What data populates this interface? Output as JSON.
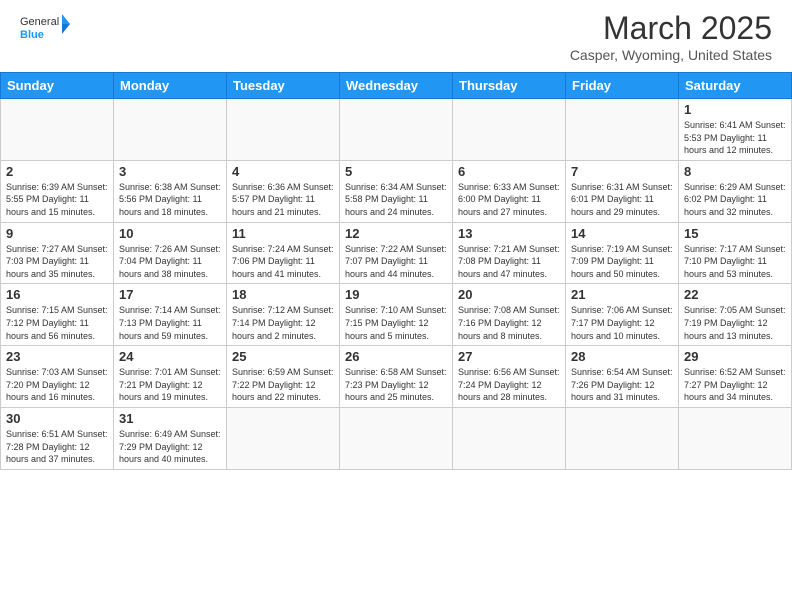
{
  "logo": {
    "text_general": "General",
    "text_blue": "Blue"
  },
  "title": "March 2025",
  "location": "Casper, Wyoming, United States",
  "weekdays": [
    "Sunday",
    "Monday",
    "Tuesday",
    "Wednesday",
    "Thursday",
    "Friday",
    "Saturday"
  ],
  "weeks": [
    [
      {
        "day": "",
        "info": ""
      },
      {
        "day": "",
        "info": ""
      },
      {
        "day": "",
        "info": ""
      },
      {
        "day": "",
        "info": ""
      },
      {
        "day": "",
        "info": ""
      },
      {
        "day": "",
        "info": ""
      },
      {
        "day": "1",
        "info": "Sunrise: 6:41 AM\nSunset: 5:53 PM\nDaylight: 11 hours and 12 minutes."
      }
    ],
    [
      {
        "day": "2",
        "info": "Sunrise: 6:39 AM\nSunset: 5:55 PM\nDaylight: 11 hours and 15 minutes."
      },
      {
        "day": "3",
        "info": "Sunrise: 6:38 AM\nSunset: 5:56 PM\nDaylight: 11 hours and 18 minutes."
      },
      {
        "day": "4",
        "info": "Sunrise: 6:36 AM\nSunset: 5:57 PM\nDaylight: 11 hours and 21 minutes."
      },
      {
        "day": "5",
        "info": "Sunrise: 6:34 AM\nSunset: 5:58 PM\nDaylight: 11 hours and 24 minutes."
      },
      {
        "day": "6",
        "info": "Sunrise: 6:33 AM\nSunset: 6:00 PM\nDaylight: 11 hours and 27 minutes."
      },
      {
        "day": "7",
        "info": "Sunrise: 6:31 AM\nSunset: 6:01 PM\nDaylight: 11 hours and 29 minutes."
      },
      {
        "day": "8",
        "info": "Sunrise: 6:29 AM\nSunset: 6:02 PM\nDaylight: 11 hours and 32 minutes."
      }
    ],
    [
      {
        "day": "9",
        "info": "Sunrise: 7:27 AM\nSunset: 7:03 PM\nDaylight: 11 hours and 35 minutes."
      },
      {
        "day": "10",
        "info": "Sunrise: 7:26 AM\nSunset: 7:04 PM\nDaylight: 11 hours and 38 minutes."
      },
      {
        "day": "11",
        "info": "Sunrise: 7:24 AM\nSunset: 7:06 PM\nDaylight: 11 hours and 41 minutes."
      },
      {
        "day": "12",
        "info": "Sunrise: 7:22 AM\nSunset: 7:07 PM\nDaylight: 11 hours and 44 minutes."
      },
      {
        "day": "13",
        "info": "Sunrise: 7:21 AM\nSunset: 7:08 PM\nDaylight: 11 hours and 47 minutes."
      },
      {
        "day": "14",
        "info": "Sunrise: 7:19 AM\nSunset: 7:09 PM\nDaylight: 11 hours and 50 minutes."
      },
      {
        "day": "15",
        "info": "Sunrise: 7:17 AM\nSunset: 7:10 PM\nDaylight: 11 hours and 53 minutes."
      }
    ],
    [
      {
        "day": "16",
        "info": "Sunrise: 7:15 AM\nSunset: 7:12 PM\nDaylight: 11 hours and 56 minutes."
      },
      {
        "day": "17",
        "info": "Sunrise: 7:14 AM\nSunset: 7:13 PM\nDaylight: 11 hours and 59 minutes."
      },
      {
        "day": "18",
        "info": "Sunrise: 7:12 AM\nSunset: 7:14 PM\nDaylight: 12 hours and 2 minutes."
      },
      {
        "day": "19",
        "info": "Sunrise: 7:10 AM\nSunset: 7:15 PM\nDaylight: 12 hours and 5 minutes."
      },
      {
        "day": "20",
        "info": "Sunrise: 7:08 AM\nSunset: 7:16 PM\nDaylight: 12 hours and 8 minutes."
      },
      {
        "day": "21",
        "info": "Sunrise: 7:06 AM\nSunset: 7:17 PM\nDaylight: 12 hours and 10 minutes."
      },
      {
        "day": "22",
        "info": "Sunrise: 7:05 AM\nSunset: 7:19 PM\nDaylight: 12 hours and 13 minutes."
      }
    ],
    [
      {
        "day": "23",
        "info": "Sunrise: 7:03 AM\nSunset: 7:20 PM\nDaylight: 12 hours and 16 minutes."
      },
      {
        "day": "24",
        "info": "Sunrise: 7:01 AM\nSunset: 7:21 PM\nDaylight: 12 hours and 19 minutes."
      },
      {
        "day": "25",
        "info": "Sunrise: 6:59 AM\nSunset: 7:22 PM\nDaylight: 12 hours and 22 minutes."
      },
      {
        "day": "26",
        "info": "Sunrise: 6:58 AM\nSunset: 7:23 PM\nDaylight: 12 hours and 25 minutes."
      },
      {
        "day": "27",
        "info": "Sunrise: 6:56 AM\nSunset: 7:24 PM\nDaylight: 12 hours and 28 minutes."
      },
      {
        "day": "28",
        "info": "Sunrise: 6:54 AM\nSunset: 7:26 PM\nDaylight: 12 hours and 31 minutes."
      },
      {
        "day": "29",
        "info": "Sunrise: 6:52 AM\nSunset: 7:27 PM\nDaylight: 12 hours and 34 minutes."
      }
    ],
    [
      {
        "day": "30",
        "info": "Sunrise: 6:51 AM\nSunset: 7:28 PM\nDaylight: 12 hours and 37 minutes."
      },
      {
        "day": "31",
        "info": "Sunrise: 6:49 AM\nSunset: 7:29 PM\nDaylight: 12 hours and 40 minutes."
      },
      {
        "day": "",
        "info": ""
      },
      {
        "day": "",
        "info": ""
      },
      {
        "day": "",
        "info": ""
      },
      {
        "day": "",
        "info": ""
      },
      {
        "day": "",
        "info": ""
      }
    ]
  ]
}
